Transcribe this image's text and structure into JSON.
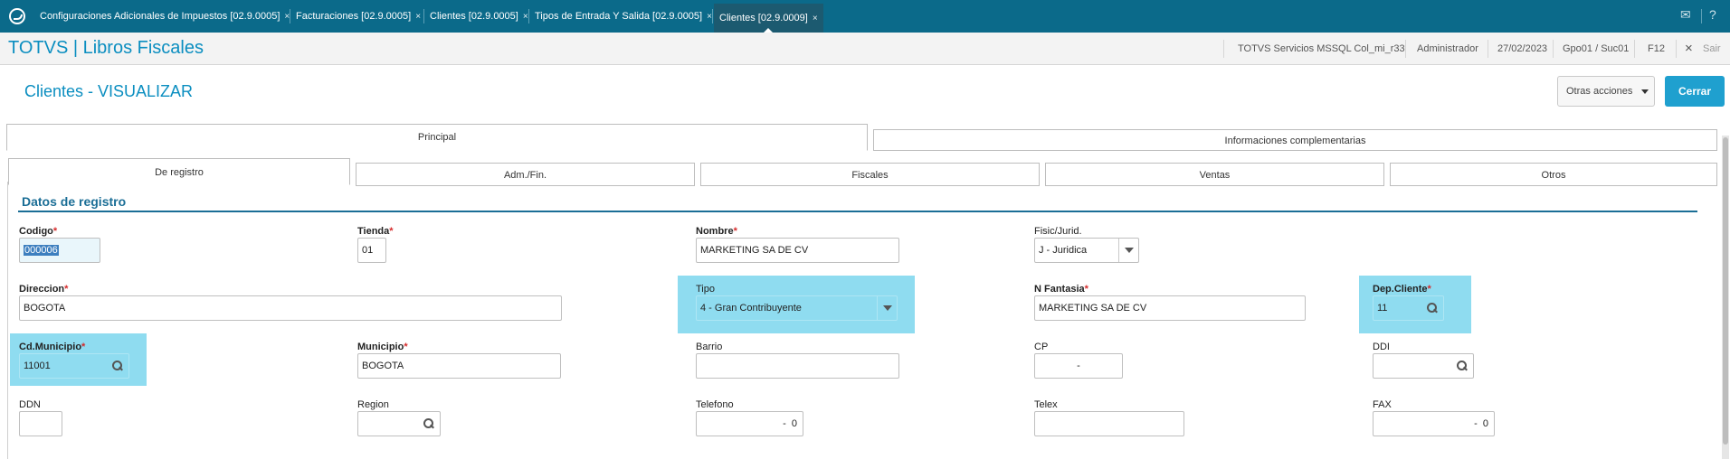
{
  "tabs": [
    {
      "label": "Configuraciones Adicionales de Impuestos [02.9.0005]"
    },
    {
      "label": "Facturaciones [02.9.0005]"
    },
    {
      "label": "Clientes [02.9.0005]"
    },
    {
      "label": "Tipos de Entrada Y Salida [02.9.0005]"
    },
    {
      "label": "Clientes [02.9.0009]"
    }
  ],
  "tab_close": "×",
  "header": {
    "brand": "TOTVS | Libros Fiscales",
    "server": "TOTVS Servicios MSSQL Col_mi_r33",
    "user": "Administrador",
    "date": "27/02/2023",
    "branch": "Gpo01 / Suc01",
    "key": "F12",
    "exit": "Sair",
    "exit_icon": "×"
  },
  "page": {
    "title": "Clientes - VISUALIZAR",
    "otras": "Otras acciones",
    "cerrar": "Cerrar"
  },
  "main_tabs": [
    "Principal",
    "Informaciones complementarias"
  ],
  "sub_tabs": [
    "De registro",
    "Adm./Fin.",
    "Fiscales",
    "Ventas",
    "Otros"
  ],
  "section": "Datos de registro",
  "required_mark": "*",
  "fields": {
    "codigo": {
      "label": "Codigo",
      "value": "000006"
    },
    "tienda": {
      "label": "Tienda",
      "value": "01"
    },
    "nombre": {
      "label": "Nombre",
      "value": "MARKETING SA DE CV"
    },
    "fisic": {
      "label": "Fisic/Jurid.",
      "value": "J - Juridica"
    },
    "direccion": {
      "label": "Direccion",
      "value": "BOGOTA"
    },
    "tipo": {
      "label": "Tipo",
      "value": "4 - Gran Contribuyente"
    },
    "nfantasia": {
      "label": "N Fantasia",
      "value": "MARKETING SA DE CV"
    },
    "depcliente": {
      "label": "Dep.Cliente",
      "value": "11"
    },
    "cdmunicipio": {
      "label": "Cd.Municipio",
      "value": "11001"
    },
    "municipio": {
      "label": "Municipio",
      "value": "BOGOTA"
    },
    "barrio": {
      "label": "Barrio",
      "value": ""
    },
    "cp": {
      "label": "CP",
      "value": "-"
    },
    "ddi": {
      "label": "DDI",
      "value": ""
    },
    "ddn": {
      "label": "DDN",
      "value": ""
    },
    "region": {
      "label": "Region",
      "value": ""
    },
    "telefono": {
      "label": "Telefono",
      "value": "-  0"
    },
    "telex": {
      "label": "Telex",
      "value": ""
    },
    "fax": {
      "label": "FAX",
      "value": "-  0"
    }
  },
  "colors": {
    "accent": "#0b8ec0",
    "tabbar": "#0b6a8a",
    "highlight": "#8fdcf0",
    "required": "#d62b2b"
  }
}
